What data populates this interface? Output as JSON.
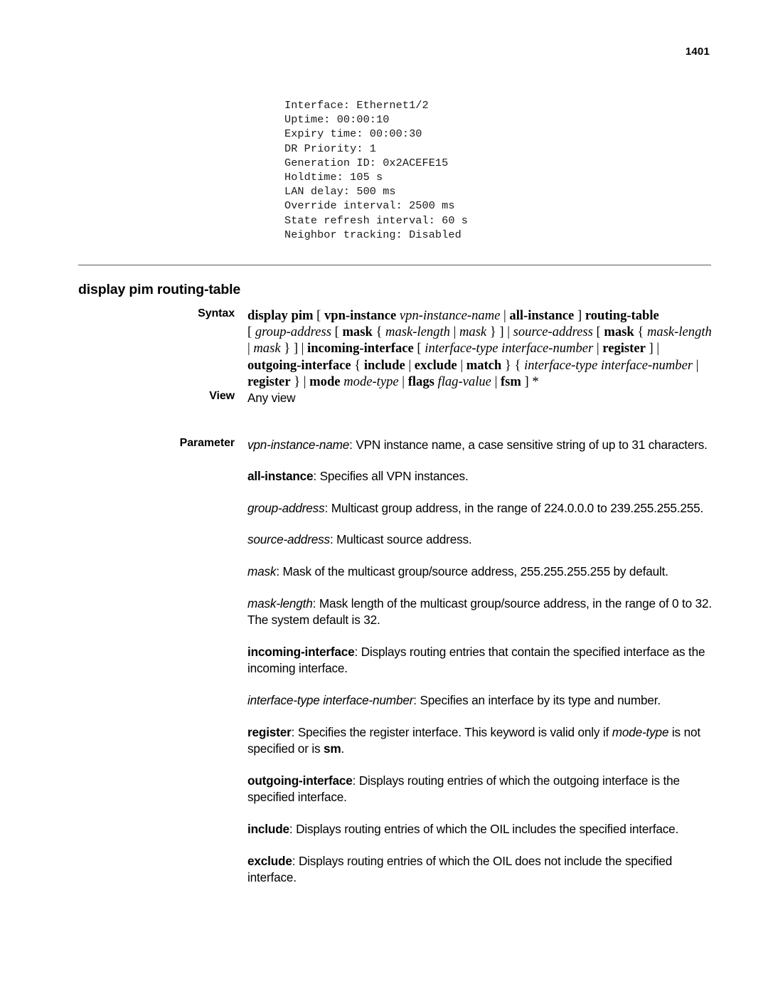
{
  "header": {
    "page_number": "1401"
  },
  "code_sample": {
    "lines": [
      "Interface: Ethernet1/2",
      "Uptime: 00:00:10",
      "Expiry time: 00:00:30",
      "DR Priority: 1",
      "Generation ID: 0x2ACEFE15",
      "Holdtime: 105 s",
      "LAN delay: 500 ms",
      "Override interval: 2500 ms",
      "State refresh interval: 60 s",
      "Neighbor tracking: Disabled"
    ]
  },
  "section": {
    "title": "display pim routing-table"
  },
  "labels": {
    "syntax": "Syntax",
    "view": "View",
    "parameter": "Parameter"
  },
  "syntax": {
    "lines_plain": [
      "display pim [ vpn-instance vpn-instance-name | all-instance ] routing-table",
      "[ group-address [ mask { mask-length | mask } ] | source-address [ mask { mask-length",
      "| mask } ] | incoming-interface [ interface-type interface-number | register ] |",
      "outgoing-interface { include | exclude | match } { interface-type interface-number |",
      "register } | mode mode-type | flags flag-value | fsm ] *"
    ],
    "lines_html": [
      "<b>display pim</b> [ <b>vpn-instance</b> <i>vpn-instance-name</i> | <b>all-instance</b> ] <b>routing-table</b>",
      "[ <i>group-address</i> [ <b>mask</b> { <i>mask-length</i> | <i>mask</i> } ] | <i>source-address</i> [ <b>mask</b> { <i>mask-length</i>",
      "| <i>mask</i> } ] | <b>incoming-interface</b> [ <i>interface-type interface-number</i> | <b>register</b> ] |",
      "<b>outgoing-interface</b> { <b>include</b> | <b>exclude</b> | <b>match</b> } { <i>interface-type interface-number</i> |",
      "<b>register</b> } | <b>mode</b> <i>mode-type</i> | <b>flags</b> <i>flag-value</i> | <b>fsm</b> ] *"
    ]
  },
  "view": {
    "text": "Any view"
  },
  "parameters": {
    "items_plain": [
      "vpn-instance-name: VPN instance name, a case sensitive string of up to 31 characters.",
      "all-instance: Specifies all VPN instances.",
      "group-address: Multicast group address, in the range of 224.0.0.0 to 239.255.255.255.",
      "source-address: Multicast source address.",
      "mask: Mask of the multicast group/source address, 255.255.255.255 by default.",
      "mask-length: Mask length of the multicast group/source address, in the range of 0 to 32. The system default is 32.",
      "incoming-interface: Displays routing entries that contain the specified interface as the incoming interface.",
      "interface-type interface-number: Specifies an interface by its type and number.",
      "register: Specifies the register interface. This keyword is valid only if mode-type is not specified or is sm.",
      "outgoing-interface: Displays routing entries of which the outgoing interface is the specified interface.",
      "include: Displays routing entries of which the OIL includes the specified interface.",
      "exclude: Displays routing entries of which the OIL does not include the specified interface."
    ],
    "items_html": [
      "<i>vpn-instance-name</i>: VPN instance name, a case sensitive string of up to 31 characters.",
      "<b>all-instance</b>: Specifies all VPN instances.",
      "<i>group-address</i>: Multicast group address, in the range of 224.0.0.0 to 239.255.255.255.",
      "<i>source-address</i>: Multicast source address.",
      "<i>mask</i>: Mask of the multicast group/source address, 255.255.255.255 by default.",
      "<i>mask-length</i>: Mask length of the multicast group/source address, in the range of 0 to 32. The system default is 32.",
      "<b>incoming-interface</b>: Displays routing entries that contain the specified interface as the incoming interface.",
      "<i>interface-type interface-number</i>: Specifies an interface by its type and number.",
      "<b>register</b>: Specifies the register interface. This keyword is valid only if <i>mode-type</i> is not specified or is <b>sm</b>.",
      "<b>outgoing-interface</b>: Displays routing entries of which the outgoing interface is the specified interface.",
      "<b>include</b>: Displays routing entries of which the OIL includes the specified interface.",
      "<b>exclude</b>: Displays routing entries of which the OIL does not include the specified interface."
    ]
  },
  "colors": {
    "text": "#000000",
    "rule": "#5a5a5a",
    "background": "#ffffff"
  }
}
